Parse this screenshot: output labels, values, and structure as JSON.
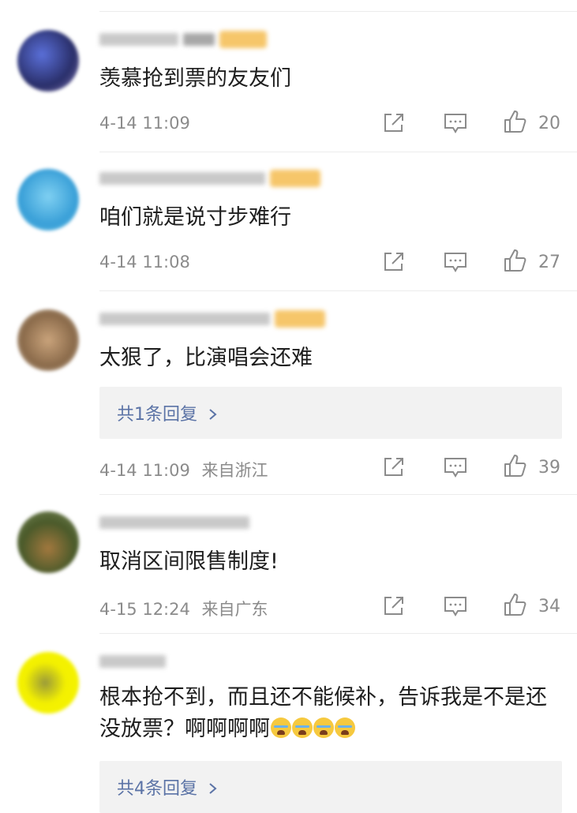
{
  "icons": {
    "share": "share-icon",
    "comment": "comment-icon",
    "like": "thumbs-up-icon",
    "reply_chevron": "chevron-right-icon"
  },
  "colors": {
    "link": "#5b73a6",
    "meta": "#8b8b8b",
    "badge": "#f6c66a",
    "reply_bg": "#f2f2f2"
  },
  "comments": [
    {
      "text": "羡慕抢到票的友友们",
      "time": "4-14 11:09",
      "location": "",
      "likes": "20"
    },
    {
      "text": "咱们就是说寸步难行",
      "time": "4-14 11:08",
      "location": "",
      "likes": "27"
    },
    {
      "text": "太狠了，比演唱会还难",
      "reply_link": "共1条回复",
      "time": "4-14 11:09",
      "location": "来自浙江",
      "likes": "39"
    },
    {
      "text": "取消区间限售制度!",
      "time": "4-15 12:24",
      "location": "来自广东",
      "likes": "34"
    },
    {
      "text": "根本抢不到，而且还不能候补，告诉我是不是还没放票？啊啊啊啊",
      "reply_link": "共4条回复"
    }
  ]
}
